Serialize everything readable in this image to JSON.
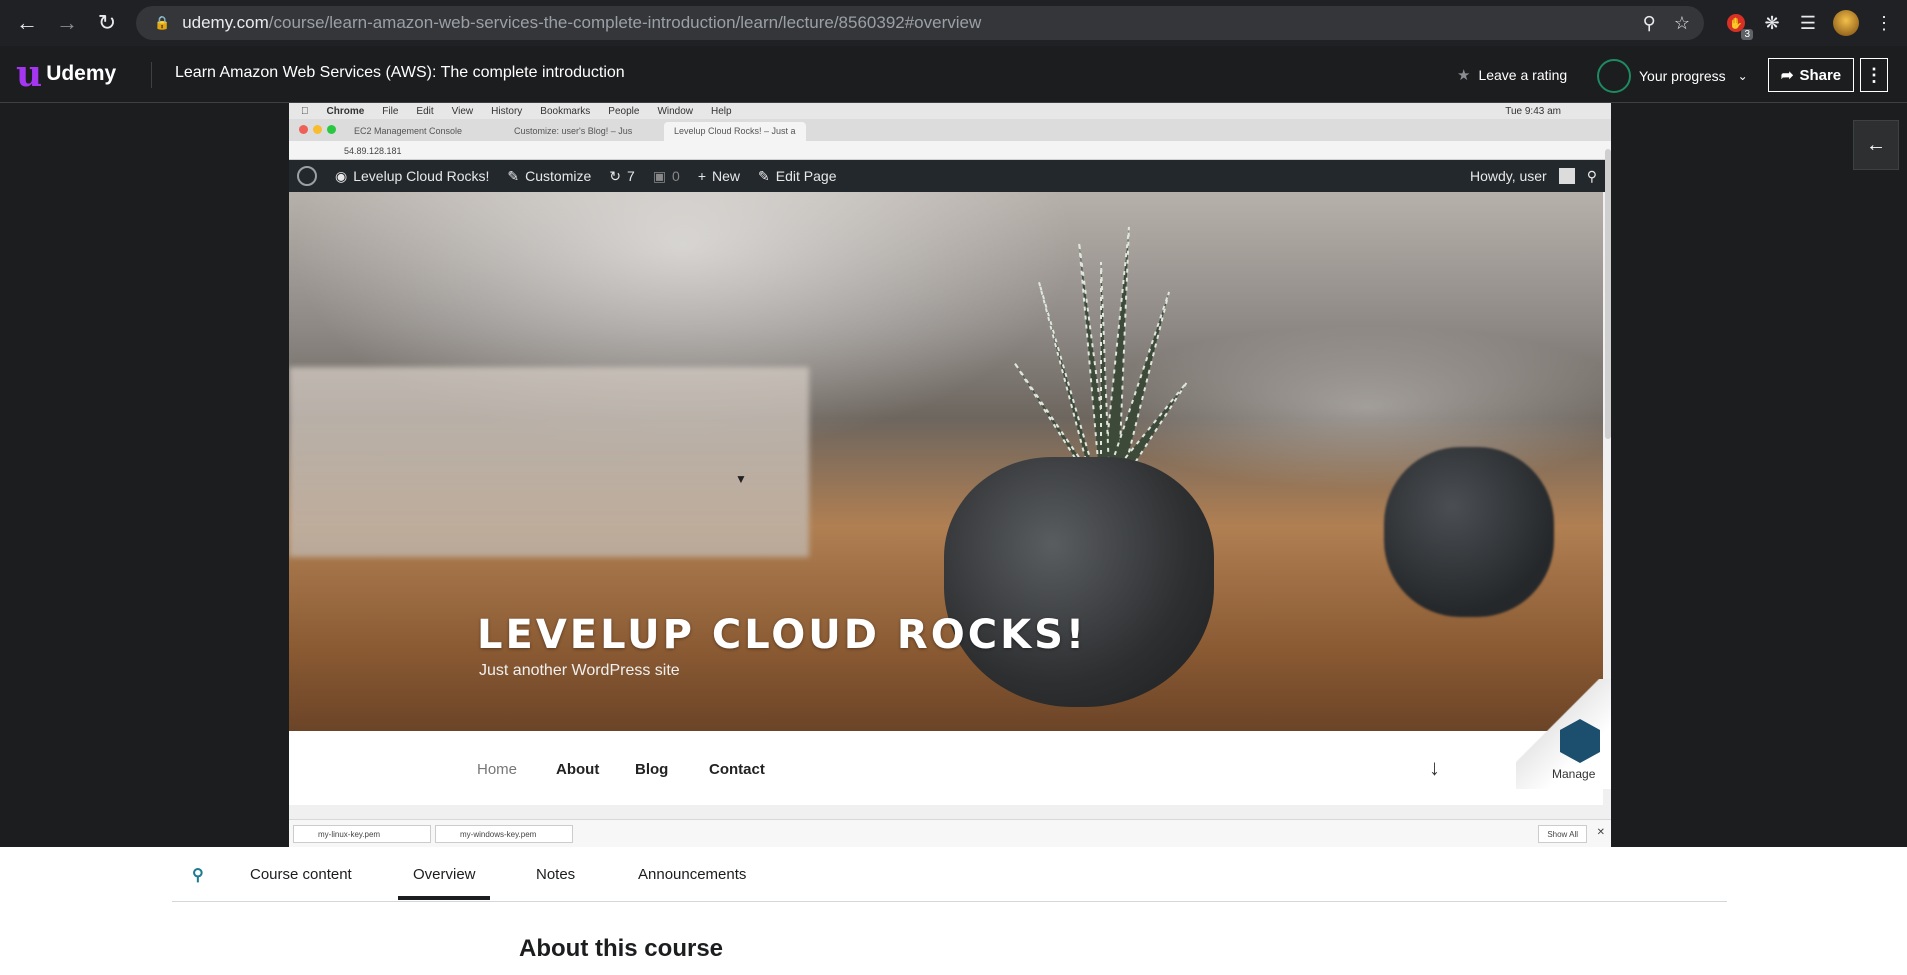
{
  "browser": {
    "url_host": "udemy.com",
    "url_path": "/course/learn-amazon-web-services-the-complete-introduction/learn/lecture/8560392#overview",
    "extension_badge": "3"
  },
  "header": {
    "logo_text": "Udemy",
    "course_title": "Learn Amazon Web Services (AWS): The complete introduction",
    "rating_label": "Leave a rating",
    "progress_label": "Your progress",
    "share_label": "Share"
  },
  "video": {
    "mac_menu": [
      "Chrome",
      "File",
      "Edit",
      "View",
      "History",
      "Bookmarks",
      "People",
      "Window",
      "Help"
    ],
    "mac_clock": "Tue 9:43 am",
    "browser_tabs": [
      "EC2 Management Console",
      "Customize: user's Blog! – Jus",
      "Levelup Cloud Rocks! – Just a"
    ],
    "inner_url": "54.89.128.181",
    "wp_bar": {
      "site_name": "Levelup Cloud Rocks!",
      "customize": "Customize",
      "updates": "7",
      "comments": "0",
      "new": "New",
      "edit_page": "Edit Page",
      "howdy": "Howdy, user"
    },
    "hero_title": "LEVELUP CLOUD ROCKS!",
    "hero_subtitle": "Just another WordPress site",
    "nav": [
      "Home",
      "About",
      "Blog",
      "Contact"
    ],
    "manage_label": "Manage",
    "downloads": [
      "my-linux-key.pem",
      "my-windows-key.pem"
    ],
    "show_all": "Show All"
  },
  "tabs": [
    "Course content",
    "Overview",
    "Notes",
    "Announcements"
  ],
  "active_tab": "Overview",
  "section_title": "About this course"
}
